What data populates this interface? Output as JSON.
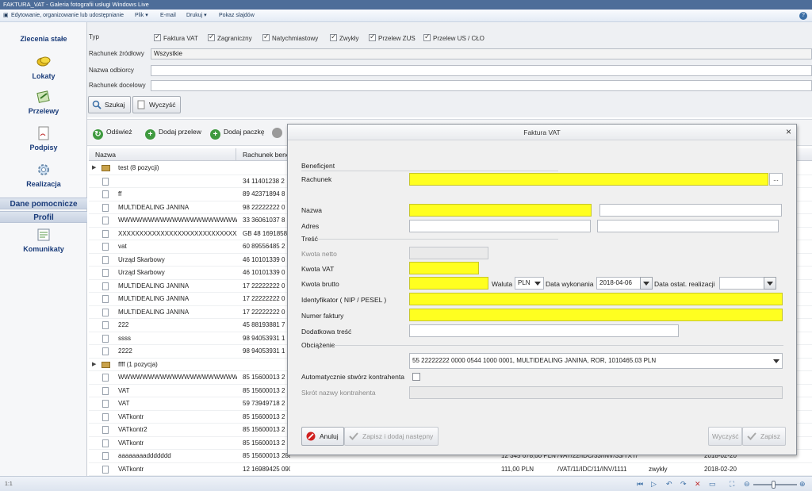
{
  "window": {
    "title": "FAKTURA_VAT - Galeria fotografii usługi Windows Live"
  },
  "menubar": {
    "items": [
      "Edytowanie, organizowanie lub udostępnianie",
      "Plik ▾",
      "E-mail",
      "Drukuj ▾",
      "Pokaz slajdów"
    ],
    "help": "?"
  },
  "sidebar": {
    "items": [
      {
        "label": "Zlecenia stałe",
        "icon": "standing-order-icon"
      },
      {
        "label": "Lokaty",
        "icon": "coins-icon"
      },
      {
        "label": "Przelewy",
        "icon": "transfer-icon"
      },
      {
        "label": "Podpisy",
        "icon": "signature-icon"
      },
      {
        "label": "Realizacja",
        "icon": "gear-icon"
      }
    ],
    "sections": [
      "Dane pomocnicze",
      "Profil"
    ],
    "profile_items": [
      {
        "label": "Komunikaty",
        "icon": "messages-icon"
      }
    ]
  },
  "filters": {
    "type_label": "Typ",
    "types": [
      "Faktura VAT",
      "Zagraniczny",
      "Natychmiastowy",
      "Zwykły",
      "Przelew ZUS",
      "Przelew US / CŁO"
    ],
    "source_label": "Rachunek źródłowy",
    "source_value": "Wszystkie",
    "recipient_label": "Nazwa odbiorcy",
    "recipient_value": "",
    "target_label": "Rachunek docelowy",
    "target_value": "",
    "search_button": "Szukaj",
    "clear_button": "Wyczyść"
  },
  "toolbar": {
    "refresh": "Odśwież",
    "add_transfer": "Dodaj przelew",
    "add_batch": "Dodaj paczkę"
  },
  "table": {
    "columns": [
      "Nazwa",
      "Rachunek bene"
    ],
    "rows": [
      {
        "kind": "group",
        "name": "test (8 pozycji)",
        "account": ""
      },
      {
        "kind": "item",
        "name": "",
        "account": "34 11401238 2"
      },
      {
        "kind": "item",
        "name": "ff",
        "account": "89 42371894 8"
      },
      {
        "kind": "item",
        "name": "MULTIDEALING JANINA",
        "account": "98 22222222 0"
      },
      {
        "kind": "item",
        "name": "WWWWWWWWWWWWWWWWWWWWWW...",
        "account": "33 36061037 8"
      },
      {
        "kind": "item",
        "name": "XXXXXXXXXXXXXXXXXXXXXXXXXXXXX...",
        "account": "GB 48 1691858"
      },
      {
        "kind": "item",
        "name": "vat",
        "account": "60 89556485 2"
      },
      {
        "kind": "item",
        "name": "Urząd Skarbowy",
        "account": "46 10101339 0"
      },
      {
        "kind": "item",
        "name": "Urząd Skarbowy",
        "account": "46 10101339 0"
      },
      {
        "kind": "item",
        "name": "MULTIDEALING JANINA",
        "account": "17 22222222 0"
      },
      {
        "kind": "item",
        "name": "MULTIDEALING JANINA",
        "account": "17 22222222 0"
      },
      {
        "kind": "item",
        "name": "MULTIDEALING JANINA",
        "account": "17 22222222 0"
      },
      {
        "kind": "item",
        "name": "222",
        "account": "45 88193881 7"
      },
      {
        "kind": "item",
        "name": "ssss",
        "account": "98 94053931 1"
      },
      {
        "kind": "item",
        "name": "2222",
        "account": "98 94053931 1"
      },
      {
        "kind": "group",
        "name": "ffff (1 pozycja)",
        "account": ""
      },
      {
        "kind": "item",
        "name": "WWWWWWWWWWWWWWWWWWWWWWW...",
        "account": "85 15600013 2"
      },
      {
        "kind": "item",
        "name": "VAT",
        "account": "85 15600013 2"
      },
      {
        "kind": "item",
        "name": "VAT",
        "account": "59 73949718 2"
      },
      {
        "kind": "item",
        "name": "VATkontr",
        "account": "85 15600013 2"
      },
      {
        "kind": "item",
        "name": "VATkontr2",
        "account": "85 15600013 2"
      },
      {
        "kind": "item",
        "name": "VATkontr",
        "account": "85 15600013 2"
      },
      {
        "kind": "item",
        "name": "aaaaaaaaddddddd",
        "account": "85 15600013 2887 3932 4000 0003",
        "amount": "12 345 678,00 PLN",
        "ref": "/VAT/22/IDC/33/INV/33/TXT/",
        "typ": "",
        "date": "2018-02-20"
      },
      {
        "kind": "item",
        "name": "VATkontr",
        "account": "12 16989425 0900 1366 4536 6688",
        "amount": "111,00 PLN",
        "ref": "/VAT/11/IDC/11/INV/1111",
        "typ": "zwykły",
        "date": "2018-02-20"
      }
    ]
  },
  "statusbar": {
    "left": "1:1"
  },
  "modal": {
    "title": "Faktura VAT",
    "close": "×",
    "beneficiary_section": "Beneficjent",
    "account_label": "Rachunek",
    "account_value": "",
    "browse_button": "...",
    "name_label": "Nazwa",
    "address_label": "Adres",
    "content_section": "Treść",
    "net_label": "Kwota netto",
    "vat_label": "Kwota VAT",
    "gross_label": "Kwota brutto",
    "currency_label": "Waluta",
    "currency_value": "PLN",
    "exec_date_label": "Data wykonania",
    "exec_date_value": "2018-04-06",
    "last_date_label": "Data ostat. realizacji",
    "last_date_value": "",
    "nip_label": "Identyfikator ( NIP / PESEL )",
    "invoice_label": "Numer faktury",
    "extra_label": "Dodatkowa treść",
    "debit_section": "Obciążenie",
    "debit_value": "55 22222222 0000 0544 1000 0001, MULTIDEALING JANINA, ROR, 1010465.03 PLN",
    "auto_contractor_label": "Automatycznie stwórz kontrahenta",
    "contractor_short_label": "Skrót nazwy kontrahenta",
    "cancel_button": "Anuluj",
    "save_add_button": "Zapisz i dodaj następny",
    "clear_button": "Wyczyść",
    "save_button": "Zapisz"
  },
  "colors": {
    "required": "#ffff20",
    "accent": "#1a3c7a"
  }
}
